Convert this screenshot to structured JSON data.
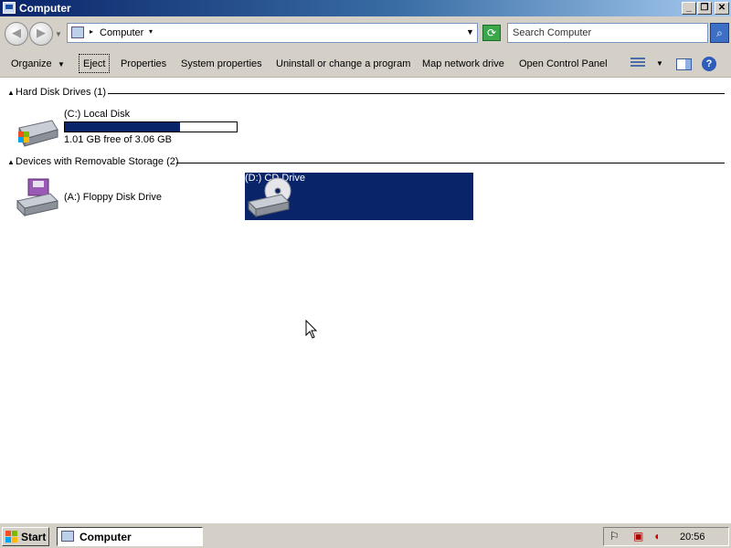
{
  "window": {
    "title": "Computer",
    "minimize": "_",
    "maximize": "❐",
    "close": "✕"
  },
  "address_bar": {
    "back": "◀",
    "forward": "▶",
    "nav_dropdown": "▼",
    "separator": "▸",
    "crumb": "Computer",
    "crumb_dropdown": "▾",
    "history_dropdown": "▼",
    "refresh": "⟳",
    "search_placeholder": "Search Computer",
    "search_button": "⌕"
  },
  "toolbar": {
    "organize": "Organize",
    "organize_dd": "▼",
    "eject": "Eject",
    "properties": "Properties",
    "system_properties": "System properties",
    "uninstall": "Uninstall or change a program",
    "map_network": "Map network drive",
    "control_panel": "Open Control Panel",
    "views_dd": "▼",
    "help": "?"
  },
  "groups": [
    {
      "chevron": "▲",
      "label": "Hard Disk Drives (1)",
      "items": [
        {
          "name": "(C:) Local Disk",
          "free_text": "1.01 GB free of 3.06 GB",
          "used_fraction": 0.67
        }
      ]
    },
    {
      "chevron": "▲",
      "label": "Devices with Removable Storage (2)",
      "items": [
        {
          "name": "(A:) Floppy Disk Drive"
        },
        {
          "name": "(D:) CD Drive",
          "selected": true
        }
      ]
    }
  ],
  "taskbar": {
    "start": "Start",
    "task_title": "Computer",
    "clock": "20:56"
  }
}
